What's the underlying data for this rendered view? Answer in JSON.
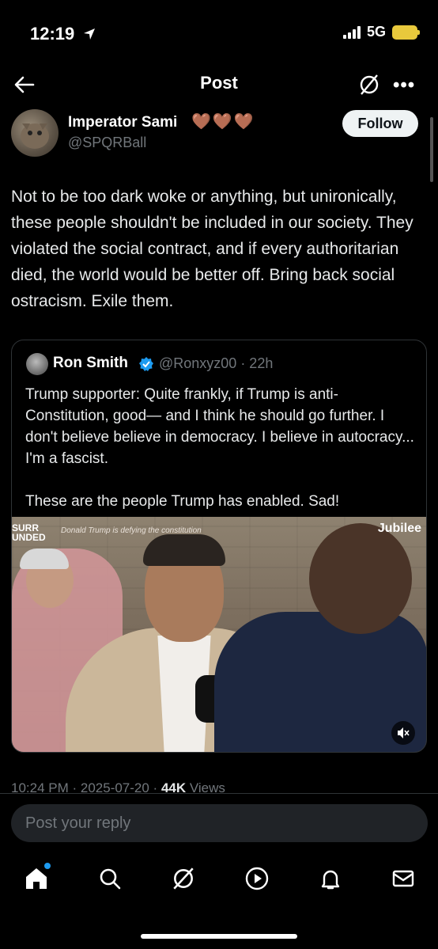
{
  "status_bar": {
    "time": "12:19",
    "network": "5G"
  },
  "header": {
    "title": "Post"
  },
  "post": {
    "author_name": "Imperator Sami",
    "author_emoji": "🤎🤎🤎",
    "handle": "@SPQRBall",
    "follow_label": "Follow",
    "text": "Not to be too dark woke or anything, but unironically, these people shouldn't be included in our society. They violated the social contract, and if every authoritarian died, the world would be better off. Bring back social ostracism. Exile them."
  },
  "quote": {
    "name": "Ron Smith",
    "handle": "@Ronxyz00 · 22h",
    "text": "Trump supporter: Quite frankly, if Trump is anti-Constitution, good— and I think he should go further. I don't believe believe in democracy. I believe in autocracy... I'm a fascist.\n\nThese are the people Trump has enabled. Sad!",
    "media": {
      "badge_line1": "SURR",
      "badge_line2": "UNDED",
      "caption": "Donald Trump is defying the constitution",
      "watermark": "Jubilee"
    }
  },
  "meta": {
    "time": "10:24 PM · 2025-07-20 · ",
    "views_count": "44K",
    "views_label": " Views"
  },
  "reply": {
    "placeholder": "Post your reply"
  },
  "colors": {
    "accent": "#1d9bf0",
    "background": "#000000",
    "muted": "#71767b"
  },
  "icons": [
    "back-arrow-icon",
    "grok-icon",
    "more-icon",
    "verified-icon",
    "mute-icon",
    "home-icon",
    "search-icon",
    "grok-icon",
    "video-icon",
    "bell-icon",
    "mail-icon"
  ]
}
